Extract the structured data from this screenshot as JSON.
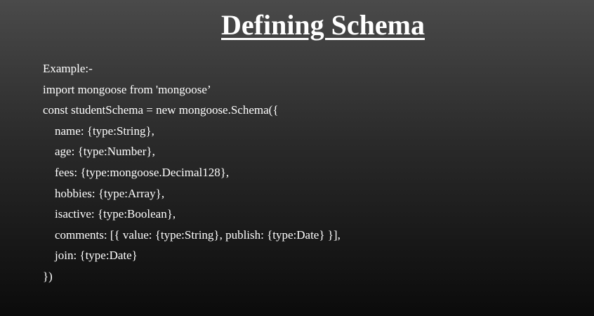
{
  "slide": {
    "title": "Defining Schema",
    "lines": [
      "Example:-",
      "import mongoose from 'mongoose’",
      "const studentSchema = new mongoose.Schema({",
      "name: {type:String},",
      "age: {type:Number},",
      "fees: {type:mongoose.Decimal128},",
      "hobbies: {type:Array},",
      "isactive: {type:Boolean},",
      "comments: [{ value: {type:String}, publish: {type:Date} }],",
      "join: {type:Date}",
      "})"
    ]
  }
}
